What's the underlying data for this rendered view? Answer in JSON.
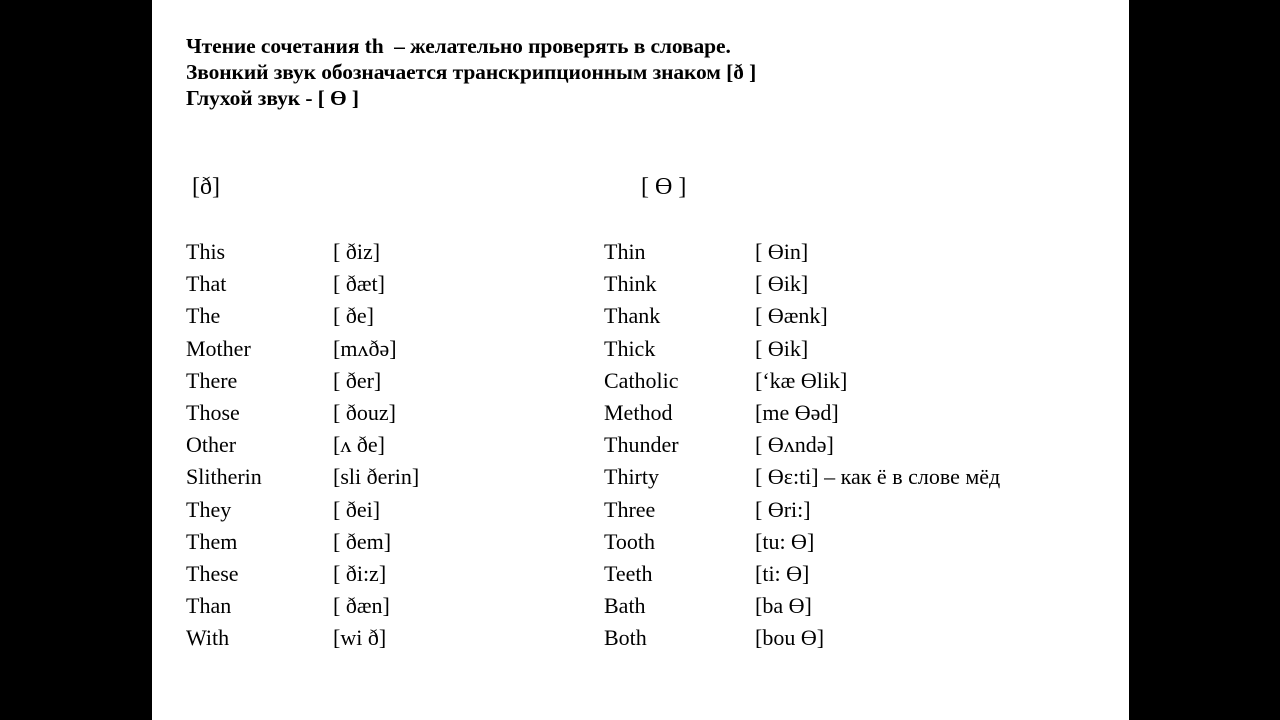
{
  "heading": {
    "line1": "Чтение сочетания th  – желательно проверять в словаре.",
    "line2": "Звонкий звук обозначается транскрипционным знаком [ð ]",
    "line3": "Глухой звук - [ Ө ]"
  },
  "sections": {
    "voiced_symbol": "[ð]",
    "voiceless_symbol": "[ Ө ]"
  },
  "voiced_words": [
    {
      "term": "This",
      "transcription": "[ ðiz]"
    },
    {
      "term": "That",
      "transcription": "[ ðæt]"
    },
    {
      "term": "The",
      "transcription": "[ ðe]"
    },
    {
      "term": "Mother",
      "transcription": "[mʌðə]"
    },
    {
      "term": "There",
      "transcription": "[ ðer]"
    },
    {
      "term": "Those",
      "transcription": "[ ðouz]"
    },
    {
      "term": "Other",
      "transcription": "[ʌ ðe]"
    },
    {
      "term": "Slitherin",
      "transcription": "[sli ðerin]"
    },
    {
      "term": "They",
      "transcription": "[ ðei]"
    },
    {
      "term": "Them",
      "transcription": "[ ðem]"
    },
    {
      "term": "These",
      "transcription": "[ ði:z]"
    },
    {
      "term": "Than",
      "transcription": "[ ðæn]"
    },
    {
      "term": "With",
      "transcription": "[wi ð]"
    }
  ],
  "voiceless_words": [
    {
      "term": "Thin",
      "transcription": "[ Өin]"
    },
    {
      "term": "Think",
      "transcription": "[ Өik]"
    },
    {
      "term": "Thank",
      "transcription": "[ Өænk]"
    },
    {
      "term": "Thick",
      "transcription": "[ Өik]"
    },
    {
      "term": "Catholic",
      "transcription": "[‘kæ Өlik]"
    },
    {
      "term": "Method",
      "transcription": "[me Өəd]"
    },
    {
      "term": "Thunder",
      "transcription": "[ Өʌndə]"
    },
    {
      "term": "Thirty",
      "transcription": "[ Өɛ:ti] – как ё в слове мёд"
    },
    {
      "term": "Three",
      "transcription": "[ Өri:]"
    },
    {
      "term": "Tooth",
      "transcription": "[tu: Ө]"
    },
    {
      "term": "Teeth",
      "transcription": "[ti: Ө]"
    },
    {
      "term": "Bath",
      "transcription": "[ba Ө]"
    },
    {
      "term": "Both",
      "transcription": "[bou Ө]"
    }
  ],
  "colors": {
    "letterbox": "#000000",
    "page_background": "#ffffff",
    "text": "#000000"
  }
}
